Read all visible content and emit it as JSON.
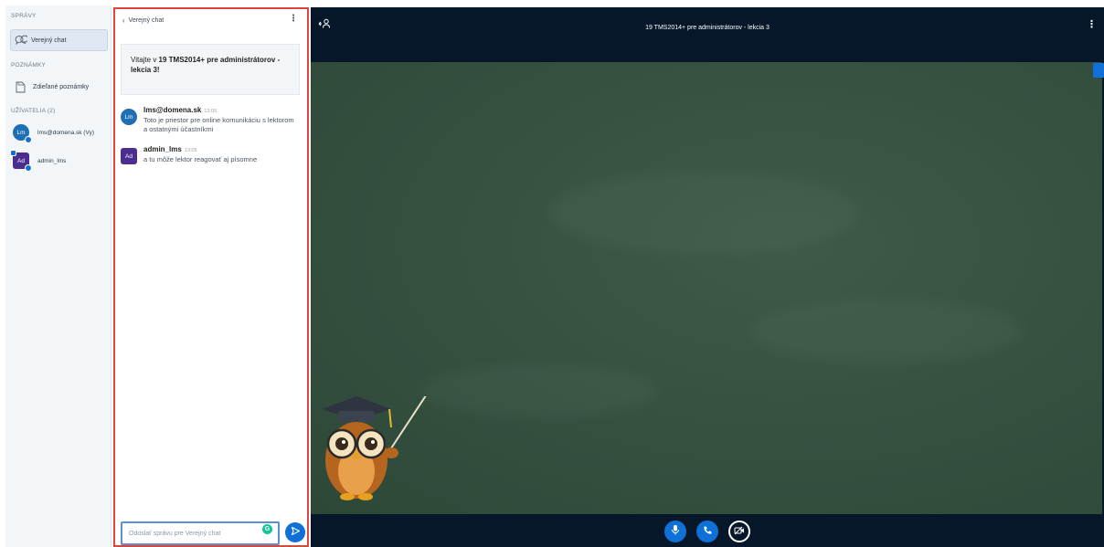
{
  "sidebar": {
    "messages_heading": "SPRÁVY",
    "public_chat_label": "Verejný chat",
    "notes_heading": "POZNÁMKY",
    "shared_notes_label": "Zdieľané poznámky",
    "users_heading": "UŽÍVATELIA (2)",
    "users": [
      {
        "initials": "Lm",
        "name": "lms@domena.sk (Vy)",
        "color": "#1f6fb5"
      },
      {
        "initials": "Ad",
        "name": "admin_lms",
        "color": "#4b2c8f"
      }
    ]
  },
  "chat": {
    "title": "Verejný chat",
    "welcome_prefix": "Vitajte v ",
    "welcome_bold": "19 TMS2014+ pre administrátorov - lekcia 3",
    "welcome_suffix": "!",
    "messages": [
      {
        "initials": "Lm",
        "name": "lms@domena.sk",
        "time": "13:05",
        "text": "Toto je priestor pre online komunikáciu s lektorom a ostatnými účastníkmi",
        "color": "#1f6fb5"
      },
      {
        "initials": "Ad",
        "name": "admin_lms",
        "time": "13:05",
        "text": "a tu môže lektor reagovať aj písomne",
        "color": "#4b2c8f"
      }
    ],
    "input_placeholder": "Odoslať správu pre Verejný chat",
    "grammarly_letter": "G"
  },
  "presentation": {
    "session_title": "19 TMS2014+ pre administrátorov - lekcia 3"
  },
  "colors": {
    "accent": "#0f70d7",
    "highlight_border": "#e0453d",
    "topbar": "#06172a",
    "chalkboard": "#34503f"
  },
  "icons": {
    "chat": "speech-bubbles-icon",
    "notes": "document-icon",
    "back": "chevron-left-icon",
    "send": "send-arrow-icon",
    "mic": "microphone-icon",
    "phone": "phone-icon",
    "camera": "video-camera-icon",
    "users_toggle": "users-toggle-icon",
    "options": "kebab-icon"
  }
}
